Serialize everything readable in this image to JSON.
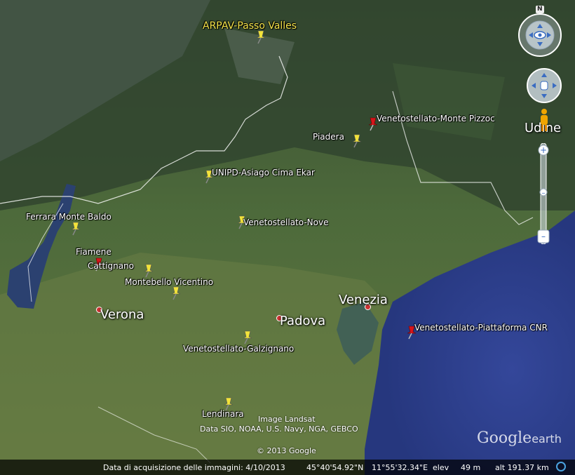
{
  "markers": [
    {
      "label": "ARPAV-Passo Valles",
      "color": "yellow",
      "style": "yellow"
    },
    {
      "label": "Venetostellato-Monte Pizzoc",
      "color": "red",
      "style": "white"
    },
    {
      "label": "Piadera",
      "color": "yellow",
      "style": "white"
    },
    {
      "label": "UNIPD-Asiago Cima Ekar",
      "color": "yellow",
      "style": "white"
    },
    {
      "label": "Ferrara Monte Baldo",
      "color": "yellow",
      "style": "white"
    },
    {
      "label": "Venetostellato-Nove",
      "color": "yellow",
      "style": "white"
    },
    {
      "label": "Fiamene",
      "color": "red",
      "style": "white"
    },
    {
      "label": "Cattignano",
      "color": "yellow",
      "style": "white"
    },
    {
      "label": "Montebello Vicentino",
      "color": "yellow",
      "style": "white"
    },
    {
      "label": "Venetostellato-Piattaforma CNR",
      "color": "red",
      "style": "white"
    },
    {
      "label": "Venetostellato-Galzignano",
      "color": "yellow",
      "style": "white"
    },
    {
      "label": "Lendinara",
      "color": "yellow",
      "style": "white"
    }
  ],
  "cities": [
    {
      "name": "Verona"
    },
    {
      "name": "Padova"
    },
    {
      "name": "Venezia"
    },
    {
      "name": "Udine"
    }
  ],
  "credits": {
    "line1": "Image Landsat",
    "line2": "Data SIO, NOAA, U.S. Navy, NGA, GEBCO",
    "copyright": "© 2013 Google"
  },
  "logo": {
    "main": "Google",
    "sub": "earth"
  },
  "status": {
    "date": "Data di acquisizione delle immagini: 4/10/2013",
    "lat": "45°40'54.92\"N",
    "lon": "11°55'32.34\"E",
    "elev_label": "elev",
    "elev_value": "49 m",
    "alt": "alt 191.37 km"
  },
  "compass": {
    "north": "N"
  },
  "colors": {
    "sea": "#2e3f8f",
    "land": "#4a6a3a",
    "mountain": "#2f4a2f",
    "pin_yellow": "#f2e33a",
    "pin_red": "#d8141a"
  }
}
